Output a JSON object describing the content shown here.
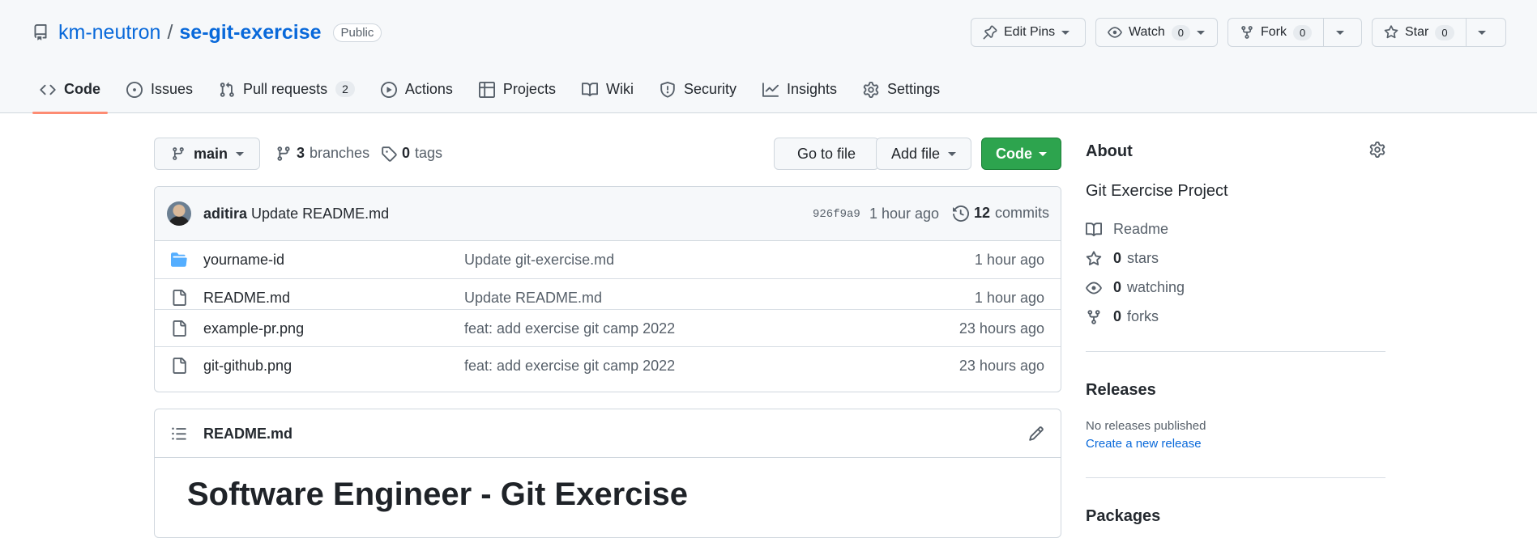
{
  "header": {
    "owner": "km-neutron",
    "separator": "/",
    "repo": "se-git-exercise",
    "visibility": "Public",
    "actions": {
      "edit_pins": "Edit Pins",
      "watch": "Watch",
      "watch_count": "0",
      "fork": "Fork",
      "fork_count": "0",
      "star": "Star",
      "star_count": "0"
    }
  },
  "nav": {
    "tabs": [
      {
        "label": "Code",
        "icon": "code-icon",
        "active": true
      },
      {
        "label": "Issues",
        "icon": "issue-icon"
      },
      {
        "label": "Pull requests",
        "icon": "pull-request-icon",
        "count": "2"
      },
      {
        "label": "Actions",
        "icon": "play-icon"
      },
      {
        "label": "Projects",
        "icon": "table-icon"
      },
      {
        "label": "Wiki",
        "icon": "book-icon"
      },
      {
        "label": "Security",
        "icon": "shield-icon"
      },
      {
        "label": "Insights",
        "icon": "graph-icon"
      },
      {
        "label": "Settings",
        "icon": "gear-icon"
      }
    ]
  },
  "file_nav": {
    "branch": "main",
    "branches_count": "3",
    "branches_label": "branches",
    "tags_count": "0",
    "tags_label": "tags",
    "go_to_file": "Go to file",
    "add_file": "Add file",
    "code": "Code"
  },
  "latest_commit": {
    "author": "aditira",
    "message": "Update README.md",
    "sha": "926f9a9",
    "time": "1 hour ago",
    "commits_count": "12",
    "commits_label": "commits"
  },
  "files": [
    {
      "name": "yourname-id",
      "type": "folder",
      "commit": "Update git-exercise.md",
      "age": "1 hour ago"
    },
    {
      "name": "README.md",
      "type": "file",
      "commit": "Update README.md",
      "age": "1 hour ago"
    },
    {
      "name": "example-pr.png",
      "type": "file",
      "commit": "feat: add exercise git camp 2022",
      "age": "23 hours ago"
    },
    {
      "name": "git-github.png",
      "type": "file",
      "commit": "feat: add exercise git camp 2022",
      "age": "23 hours ago"
    }
  ],
  "readme": {
    "filename": "README.md",
    "heading": "Software Engineer - Git Exercise"
  },
  "sidebar": {
    "about_title": "About",
    "description": "Git Exercise Project",
    "readme_label": "Readme",
    "stars_count": "0",
    "stars_label": "stars",
    "watching_count": "0",
    "watching_label": "watching",
    "forks_count": "0",
    "forks_label": "forks",
    "releases_title": "Releases",
    "no_releases": "No releases published",
    "create_release": "Create a new release",
    "packages_title": "Packages"
  },
  "colors": {
    "accent_link": "#0969da",
    "code_button": "#2da44e",
    "active_tab_underline": "#fd8c73",
    "folder": "#54aeff"
  }
}
